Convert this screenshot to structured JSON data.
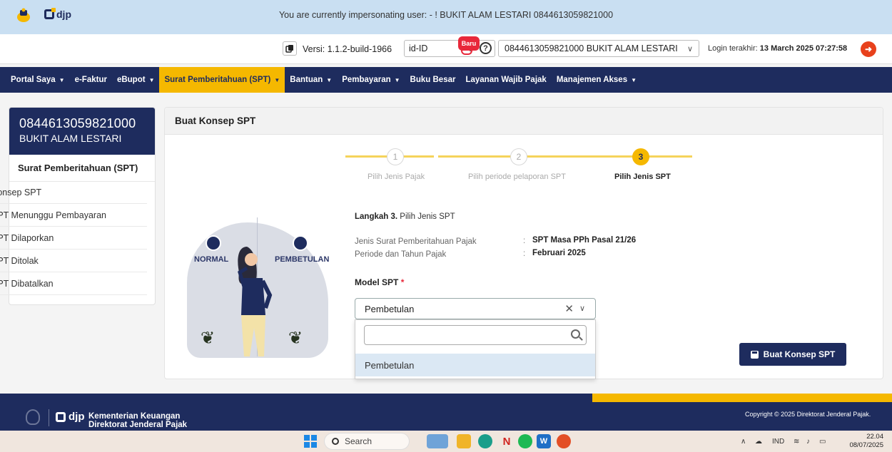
{
  "impersonation_banner": "You are currently impersonating user: - ! BUKIT ALAM LESTARI 0844613059821000",
  "topbar": {
    "logo_text": "djp",
    "versi_label": "Versi: 1.1.2-build-1966",
    "language": "id-ID",
    "new_badge": "Baru",
    "taxpayer": "0844613059821000 BUKIT ALAM LESTARI",
    "last_login_label": "Login terakhir:",
    "last_login_value": "13 March 2025 07:27:58"
  },
  "nav": {
    "portal_saya": "Portal Saya",
    "efaktur": "e-Faktur",
    "ebupot": "eBupot",
    "spt": "Surat Pemberitahuan (SPT)",
    "bantuan": "Bantuan",
    "pembayaran": "Pembayaran",
    "buku_besar": "Buku Besar",
    "layanan": "Layanan Wajib Pajak",
    "manajemen": "Manajemen Akses"
  },
  "sidebar": {
    "npwp": "0844613059821000",
    "name": "BUKIT ALAM LESTARI",
    "section_title": "Surat Pemberitahuan (SPT)",
    "items": [
      "Konsep SPT",
      "SPT Menunggu Pembayaran",
      "SPT Dilaporkan",
      "SPT Ditolak",
      "SPT Dibatalkan"
    ]
  },
  "main": {
    "title": "Buat Konsep SPT",
    "steps": [
      {
        "number": "1",
        "label": "Pilih Jenis Pajak"
      },
      {
        "number": "2",
        "label": "Pilih periode pelaporan SPT"
      },
      {
        "number": "3",
        "label": "Pilih Jenis SPT"
      }
    ],
    "illustration": {
      "left_label": "NORMAL",
      "right_label": "PEMBETULAN"
    },
    "step_prefix": "Langkah 3.",
    "step_title": "Pilih Jenis SPT",
    "fields": [
      {
        "label": "Jenis Surat Pemberitahuan Pajak",
        "colon": ":",
        "value": "SPT Masa PPh Pasal 21/26"
      },
      {
        "label": "Periode dan Tahun Pajak",
        "colon": ":",
        "value": "Februari 2025"
      }
    ],
    "model_label": "Model SPT",
    "required_mark": "*",
    "model_value": "Pembetulan",
    "search_placeholder": "",
    "dropdown_options": [
      "Pembetulan"
    ],
    "submit_label": "Buat Konsep SPT"
  },
  "footer": {
    "logo_text": "djp",
    "org_line1": "Kementerian Keuangan",
    "org_line2": "Direktorat Jenderal Pajak",
    "copyright": "Copyright © 2025 Direktorat Jenderal Pajak."
  },
  "taskbar": {
    "search_label": "Search",
    "tray_lang": "IND",
    "time": "22.04",
    "date": "08/07/2025"
  },
  "colors": {
    "navy": "#1e2c5e",
    "accent_yellow": "#f5b800",
    "banner_blue": "#c9dff2",
    "logout_red": "#e8411c"
  }
}
